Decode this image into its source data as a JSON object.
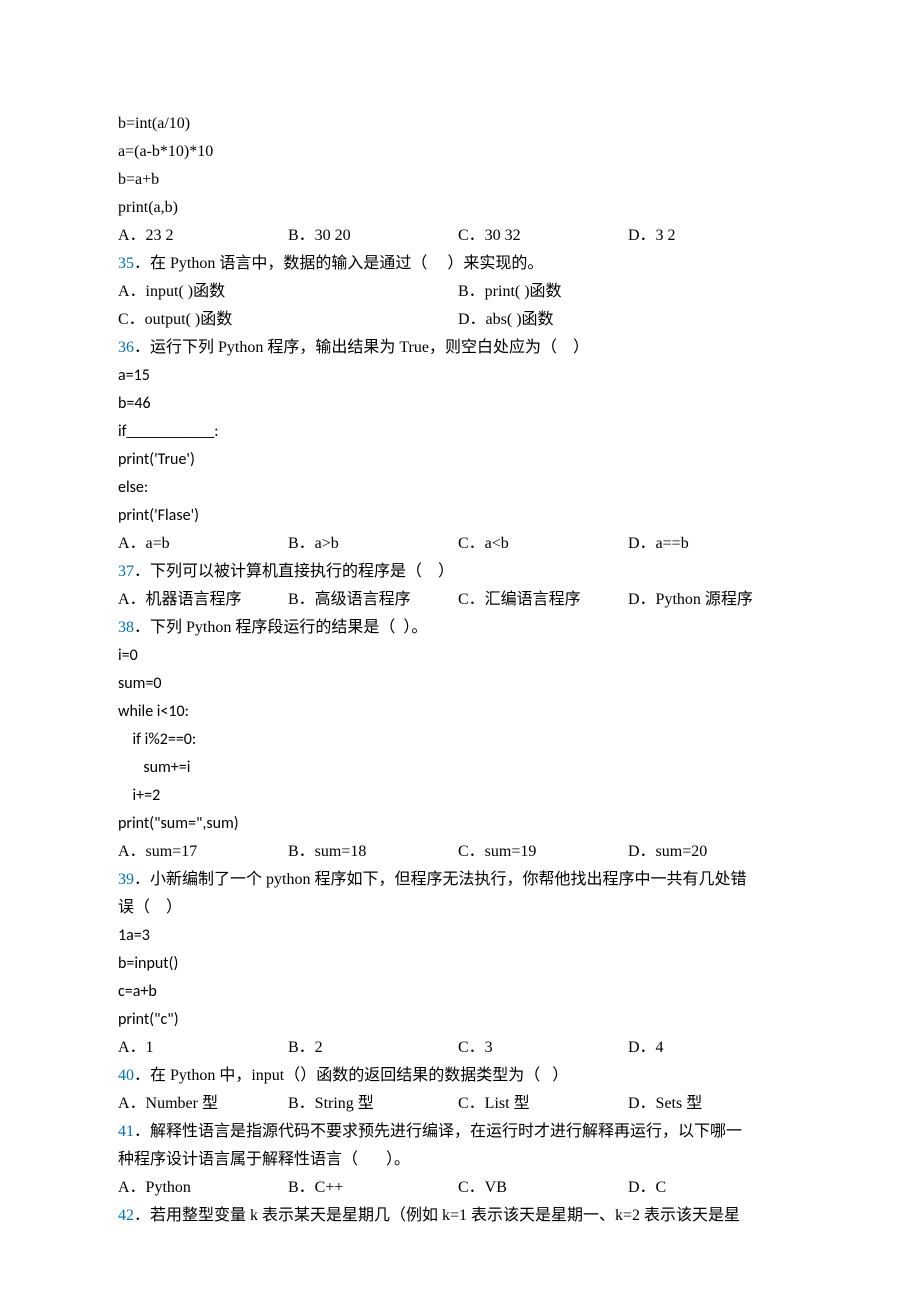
{
  "code1": {
    "l1": "b=int(a/10)",
    "l2": "a=(a-b*10)*10",
    "l3": "b=a+b",
    "l4": "print(a,b)"
  },
  "q34": {
    "A": "A．23 2",
    "B": "B．30 20",
    "C": "C．30 32",
    "D": "D．3  2"
  },
  "q35": {
    "num": "35",
    "text": "．在 Python 语言中，数据的输入是通过（     ）来实现的。",
    "A": "A．input( )函数",
    "B": "B．print( )函数",
    "C": "C．output( )函数",
    "D": "D．abs( )函数"
  },
  "q36": {
    "num": "36",
    "text": "．运行下列 Python 程序，输出结果为 True，则空白处应为（    ）",
    "c1": "a=15",
    "c2": "b=46",
    "c3": "if___________:",
    "c4": "print('True')",
    "c5": "else:",
    "c6": "print('Flase')",
    "A": "A．a=b",
    "B": "B．a>b",
    "C": "C．a<b",
    "D": "D．a==b"
  },
  "q37": {
    "num": "37",
    "text": "．下列可以被计算机直接执行的程序是（    ）",
    "A": "A．机器语言程序",
    "B": "B．高级语言程序",
    "C": "C．汇编语言程序",
    "D": "D．Python 源程序"
  },
  "q38": {
    "num": "38",
    "text": "．下列 Python 程序段运行的结果是（  ）。",
    "c1": "i=0",
    "c2": "sum=0",
    "c3": "while i<10:",
    "c4": "    if i%2==0:",
    "c5": "       sum+=i",
    "c6": "    i+=2",
    "c7": "print(\"sum=\",sum)",
    "A": "A．sum=17",
    "B": "B．sum=18",
    "C": "C．sum=19",
    "D": "D．sum=20"
  },
  "q39": {
    "num": "39",
    "text1": "．小新编制了一个 python 程序如下，但程序无法执行，你帮他找出程序中一共有几处错",
    "text2": "误（    ）",
    "c1": "1a=3",
    "c2": "b=input()",
    "c3": "c=a+b",
    "c4": "print(\"c\")",
    "A": "A．1",
    "B": "B．2",
    "C": "C．3",
    "D": "D．4"
  },
  "q40": {
    "num": "40",
    "text": "．在 Python 中，input（）函数的返回结果的数据类型为（   ）",
    "A": "A．Number 型",
    "B": "B．String 型",
    "C": "C．List 型",
    "D": "D．Sets 型"
  },
  "q41": {
    "num": "41",
    "text1": "．解释性语言是指源代码不要求预先进行编译，在运行时才进行解释再运行，以下哪一",
    "text2": "种程序设计语言属于解释性语言（       ）。",
    "A": "A．Python",
    "B": "B．C++",
    "C": "C．VB",
    "D": "D．C"
  },
  "q42": {
    "num": "42",
    "text": "．若用整型变量 k 表示某天是星期几（例如 k=1 表示该天是星期一、k=2 表示该天是星"
  }
}
